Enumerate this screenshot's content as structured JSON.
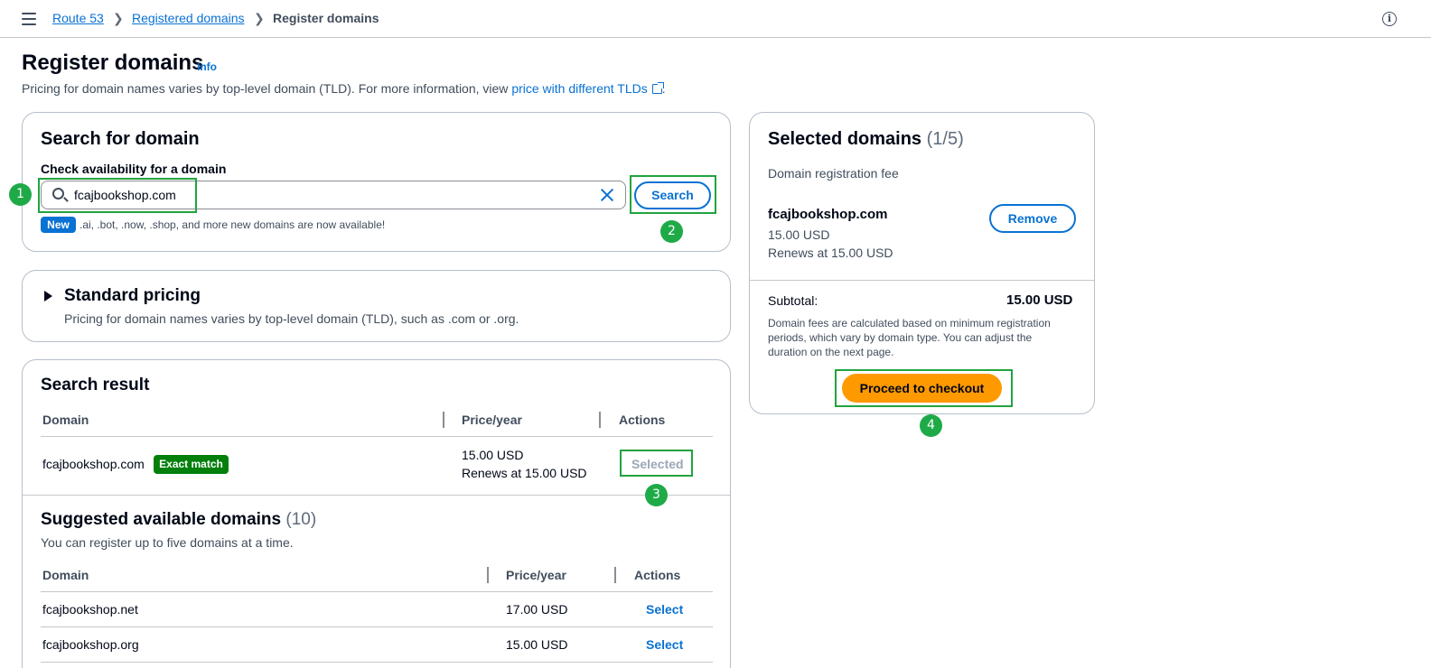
{
  "breadcrumb": {
    "items": [
      "Route 53",
      "Registered domains"
    ],
    "current": "Register domains"
  },
  "page": {
    "title": "Register domains",
    "info_label": "Info",
    "description_prefix": "Pricing for domain names varies by top-level domain (TLD). For more information, view ",
    "description_link": "price with different TLDs",
    "description_suffix": "."
  },
  "search_card": {
    "title": "Search for domain",
    "field_label": "Check availability for a domain",
    "input_value": "fcajbookshop.com",
    "search_button": "Search",
    "new_badge": "New",
    "new_note": ".ai, .bot, .now, .shop, and more new domains are now available!"
  },
  "pricing_card": {
    "title": "Standard pricing",
    "description": "Pricing for domain names varies by top-level domain (TLD), such as .com or .org."
  },
  "result_card": {
    "title": "Search result",
    "columns": [
      "Domain",
      "Price/year",
      "Actions"
    ],
    "row": {
      "domain": "fcajbookshop.com",
      "badge": "Exact match",
      "price": "15.00 USD",
      "renews": "Renews at 15.00 USD",
      "action": "Selected"
    },
    "suggested": {
      "title": "Suggested available domains",
      "count": "(10)",
      "note": "You can register up to five domains at a time.",
      "columns": [
        "Domain",
        "Price/year",
        "Actions"
      ],
      "rows": [
        {
          "domain": "fcajbookshop.net",
          "price": "17.00 USD",
          "action": "Select"
        },
        {
          "domain": "fcajbookshop.org",
          "price": "15.00 USD",
          "action": "Select"
        }
      ]
    }
  },
  "selected_card": {
    "title": "Selected domains",
    "count": "(1/5)",
    "fee_label": "Domain registration fee",
    "domain": "fcajbookshop.com",
    "price": "15.00 USD",
    "renews": "Renews at 15.00 USD",
    "remove_button": "Remove",
    "subtotal_label": "Subtotal:",
    "subtotal_value": "15.00 USD",
    "note": [
      "Domain fees are calculated based on minimum registration",
      "periods, which vary by domain type. You can adjust the",
      "duration on the next page."
    ],
    "checkout_button": "Proceed to checkout"
  },
  "steps": [
    "1",
    "2",
    "3",
    "4"
  ],
  "colors": {
    "accent": "#0972d3",
    "checkout": "#ff9900",
    "highlight": "#22a33f",
    "exact_match": "#037f0c"
  }
}
